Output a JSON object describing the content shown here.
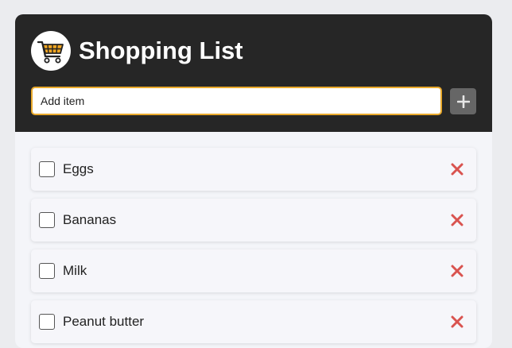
{
  "app": {
    "title": "Shopping List",
    "logo_icon": "shopping-cart-icon"
  },
  "add_form": {
    "placeholder": "Add item",
    "button_icon": "plus-icon"
  },
  "items": [
    {
      "label": "Eggs",
      "checked": false
    },
    {
      "label": "Bananas",
      "checked": false
    },
    {
      "label": "Milk",
      "checked": false
    },
    {
      "label": "Peanut butter",
      "checked": false
    }
  ],
  "colors": {
    "header_bg": "#262626",
    "input_focus_border": "#e9a92c",
    "delete_icon": "#d9534f",
    "add_button_bg": "#666666"
  }
}
